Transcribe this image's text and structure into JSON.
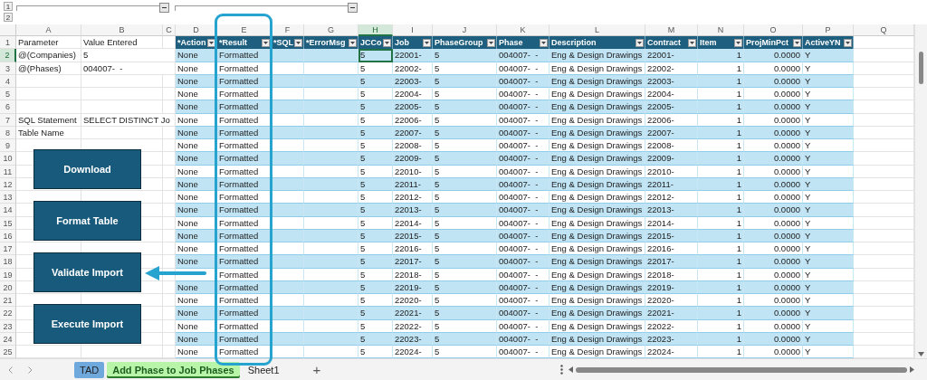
{
  "outline": {
    "levels": [
      "1",
      "2"
    ]
  },
  "columns": [
    {
      "letter": "A",
      "selected": false
    },
    {
      "letter": "B",
      "selected": false
    },
    {
      "letter": "C",
      "selected": false
    },
    {
      "letter": "D",
      "selected": false
    },
    {
      "letter": "E",
      "selected": false
    },
    {
      "letter": "F",
      "selected": false
    },
    {
      "letter": "G",
      "selected": false
    },
    {
      "letter": "H",
      "selected": true
    },
    {
      "letter": "I",
      "selected": false
    },
    {
      "letter": "J",
      "selected": false
    },
    {
      "letter": "K",
      "selected": false
    },
    {
      "letter": "L",
      "selected": false
    },
    {
      "letter": "M",
      "selected": false
    },
    {
      "letter": "N",
      "selected": false
    },
    {
      "letter": "O",
      "selected": false
    },
    {
      "letter": "P",
      "selected": false
    },
    {
      "letter": "Q",
      "selected": false
    }
  ],
  "header_row": {
    "number": "1",
    "selected": false,
    "parameter": "Parameter",
    "value": "Value Entered"
  },
  "table_columns": [
    "*Action",
    "*Result",
    "*SQL",
    "*ErrorMsg",
    "JCCo",
    "Job",
    "PhaseGroup",
    "Phase",
    "Description",
    "Contract",
    "Item",
    "ProjMinPct",
    "ActiveYN"
  ],
  "rows": [
    {
      "number": "2",
      "selected": true,
      "parameter": "@(Companies)",
      "value": "5",
      "action": "None",
      "result": "Formatted",
      "jcco": "5",
      "job": "22001-",
      "phase_group": "5",
      "phase": "004007-  -",
      "description": "Eng & Design Drawings",
      "contract": "22001-",
      "item": "1",
      "proj_min_pct": "0.0000",
      "active_yn": "Y"
    },
    {
      "number": "3",
      "selected": false,
      "parameter": "@(Phases)",
      "value": "004007-  -",
      "action": "None",
      "result": "Formatted",
      "jcco": "5",
      "job": "22002-",
      "phase_group": "5",
      "phase": "004007-  -",
      "description": "Eng & Design Drawings",
      "contract": "22002-",
      "item": "1",
      "proj_min_pct": "0.0000",
      "active_yn": "Y"
    },
    {
      "number": "4",
      "selected": false,
      "action": "None",
      "result": "Formatted",
      "jcco": "5",
      "job": "22003-",
      "phase_group": "5",
      "phase": "004007-  -",
      "description": "Eng & Design Drawings",
      "contract": "22003-",
      "item": "1",
      "proj_min_pct": "0.0000",
      "active_yn": "Y"
    },
    {
      "number": "5",
      "selected": false,
      "action": "None",
      "result": "Formatted",
      "jcco": "5",
      "job": "22004-",
      "phase_group": "5",
      "phase": "004007-  -",
      "description": "Eng & Design Drawings",
      "contract": "22004-",
      "item": "1",
      "proj_min_pct": "0.0000",
      "active_yn": "Y"
    },
    {
      "number": "6",
      "selected": false,
      "action": "None",
      "result": "Formatted",
      "jcco": "5",
      "job": "22005-",
      "phase_group": "5",
      "phase": "004007-  -",
      "description": "Eng & Design Drawings",
      "contract": "22005-",
      "item": "1",
      "proj_min_pct": "0.0000",
      "active_yn": "Y"
    },
    {
      "number": "7",
      "selected": false,
      "parameter": "SQL Statement",
      "value": "SELECT DISTINCT Jo",
      "action": "None",
      "result": "Formatted",
      "jcco": "5",
      "job": "22006-",
      "phase_group": "5",
      "phase": "004007-  -",
      "description": "Eng & Design Drawings",
      "contract": "22006-",
      "item": "1",
      "proj_min_pct": "0.0000",
      "active_yn": "Y"
    },
    {
      "number": "8",
      "selected": false,
      "parameter": "Table Name",
      "action": "None",
      "result": "Formatted",
      "jcco": "5",
      "job": "22007-",
      "phase_group": "5",
      "phase": "004007-  -",
      "description": "Eng & Design Drawings",
      "contract": "22007-",
      "item": "1",
      "proj_min_pct": "0.0000",
      "active_yn": "Y"
    },
    {
      "number": "9",
      "selected": false,
      "action": "None",
      "result": "Formatted",
      "jcco": "5",
      "job": "22008-",
      "phase_group": "5",
      "phase": "004007-  -",
      "description": "Eng & Design Drawings",
      "contract": "22008-",
      "item": "1",
      "proj_min_pct": "0.0000",
      "active_yn": "Y"
    },
    {
      "number": "10",
      "selected": false,
      "action": "None",
      "result": "Formatted",
      "jcco": "5",
      "job": "22009-",
      "phase_group": "5",
      "phase": "004007-  -",
      "description": "Eng & Design Drawings",
      "contract": "22009-",
      "item": "1",
      "proj_min_pct": "0.0000",
      "active_yn": "Y"
    },
    {
      "number": "11",
      "selected": false,
      "action": "None",
      "result": "Formatted",
      "jcco": "5",
      "job": "22010-",
      "phase_group": "5",
      "phase": "004007-  -",
      "description": "Eng & Design Drawings",
      "contract": "22010-",
      "item": "1",
      "proj_min_pct": "0.0000",
      "active_yn": "Y"
    },
    {
      "number": "12",
      "selected": false,
      "action": "None",
      "result": "Formatted",
      "jcco": "5",
      "job": "22011-",
      "phase_group": "5",
      "phase": "004007-  -",
      "description": "Eng & Design Drawings",
      "contract": "22011-",
      "item": "1",
      "proj_min_pct": "0.0000",
      "active_yn": "Y"
    },
    {
      "number": "13",
      "selected": false,
      "action": "None",
      "result": "Formatted",
      "jcco": "5",
      "job": "22012-",
      "phase_group": "5",
      "phase": "004007-  -",
      "description": "Eng & Design Drawings",
      "contract": "22012-",
      "item": "1",
      "proj_min_pct": "0.0000",
      "active_yn": "Y"
    },
    {
      "number": "14",
      "selected": false,
      "action": "None",
      "result": "Formatted",
      "jcco": "5",
      "job": "22013-",
      "phase_group": "5",
      "phase": "004007-  -",
      "description": "Eng & Design Drawings",
      "contract": "22013-",
      "item": "1",
      "proj_min_pct": "0.0000",
      "active_yn": "Y"
    },
    {
      "number": "15",
      "selected": false,
      "action": "None",
      "result": "Formatted",
      "jcco": "5",
      "job": "22014-",
      "phase_group": "5",
      "phase": "004007-  -",
      "description": "Eng & Design Drawings",
      "contract": "22014-",
      "item": "1",
      "proj_min_pct": "0.0000",
      "active_yn": "Y"
    },
    {
      "number": "16",
      "selected": false,
      "action": "None",
      "result": "Formatted",
      "jcco": "5",
      "job": "22015-",
      "phase_group": "5",
      "phase": "004007-  -",
      "description": "Eng & Design Drawings",
      "contract": "22015-",
      "item": "1",
      "proj_min_pct": "0.0000",
      "active_yn": "Y"
    },
    {
      "number": "17",
      "selected": false,
      "action": "None",
      "result": "Formatted",
      "jcco": "5",
      "job": "22016-",
      "phase_group": "5",
      "phase": "004007-  -",
      "description": "Eng & Design Drawings",
      "contract": "22016-",
      "item": "1",
      "proj_min_pct": "0.0000",
      "active_yn": "Y"
    },
    {
      "number": "18",
      "selected": false,
      "action": "None",
      "result": "Formatted",
      "jcco": "5",
      "job": "22017-",
      "phase_group": "5",
      "phase": "004007-  -",
      "description": "Eng & Design Drawings",
      "contract": "22017-",
      "item": "1",
      "proj_min_pct": "0.0000",
      "active_yn": "Y"
    },
    {
      "number": "19",
      "selected": false,
      "result": "Formatted",
      "jcco": "5",
      "job": "22018-",
      "phase_group": "5",
      "phase": "004007-  -",
      "description": "Eng & Design Drawings",
      "contract": "22018-",
      "item": "1",
      "proj_min_pct": "0.0000",
      "active_yn": "Y"
    },
    {
      "number": "20",
      "selected": false,
      "action": "None",
      "result": "Formatted",
      "jcco": "5",
      "job": "22019-",
      "phase_group": "5",
      "phase": "004007-  -",
      "description": "Eng & Design Drawings",
      "contract": "22019-",
      "item": "1",
      "proj_min_pct": "0.0000",
      "active_yn": "Y"
    },
    {
      "number": "21",
      "selected": false,
      "action": "None",
      "result": "Formatted",
      "jcco": "5",
      "job": "22020-",
      "phase_group": "5",
      "phase": "004007-  -",
      "description": "Eng & Design Drawings",
      "contract": "22020-",
      "item": "1",
      "proj_min_pct": "0.0000",
      "active_yn": "Y"
    },
    {
      "number": "22",
      "selected": false,
      "action": "None",
      "result": "Formatted",
      "jcco": "5",
      "job": "22021-",
      "phase_group": "5",
      "phase": "004007-  -",
      "description": "Eng & Design Drawings",
      "contract": "22021-",
      "item": "1",
      "proj_min_pct": "0.0000",
      "active_yn": "Y"
    },
    {
      "number": "23",
      "selected": false,
      "action": "None",
      "result": "Formatted",
      "jcco": "5",
      "job": "22022-",
      "phase_group": "5",
      "phase": "004007-  -",
      "description": "Eng & Design Drawings",
      "contract": "22022-",
      "item": "1",
      "proj_min_pct": "0.0000",
      "active_yn": "Y"
    },
    {
      "number": "24",
      "selected": false,
      "action": "None",
      "result": "Formatted",
      "jcco": "5",
      "job": "22023-",
      "phase_group": "5",
      "phase": "004007-  -",
      "description": "Eng & Design Drawings",
      "contract": "22023-",
      "item": "1",
      "proj_min_pct": "0.0000",
      "active_yn": "Y"
    },
    {
      "number": "25",
      "selected": false,
      "action": "None",
      "result": "Formatted",
      "jcco": "5",
      "job": "22024-",
      "phase_group": "5",
      "phase": "004007-  -",
      "description": "Eng & Design Drawings",
      "contract": "22024-",
      "item": "1",
      "proj_min_pct": "0.0000",
      "active_yn": "Y"
    }
  ],
  "buttons": [
    {
      "label": "Download"
    },
    {
      "label": "Format Table"
    },
    {
      "label": "Validate Import"
    },
    {
      "label": "Execute Import"
    }
  ],
  "sheet_tabs": [
    {
      "label": "TAD",
      "selected": false,
      "color": "#6fa8dc"
    },
    {
      "label": "Add Phase to Job Phases",
      "selected": true,
      "color": "#b8f5a8"
    },
    {
      "label": "Sheet1",
      "selected": false
    }
  ],
  "add_sheet": "+"
}
